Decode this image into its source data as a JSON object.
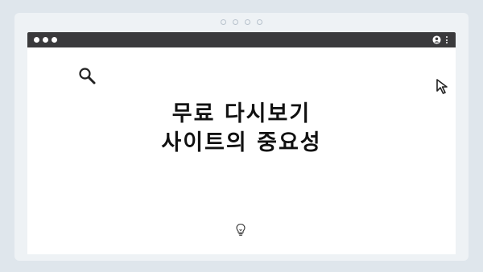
{
  "window": {
    "controls": [
      "close",
      "minimize",
      "maximize"
    ],
    "toolbar_icons": [
      "user-icon",
      "kebab-menu-icon"
    ]
  },
  "icons": [
    "search-icon",
    "cursor-icon",
    "lightbulb-icon"
  ],
  "headline": {
    "line1": "무료 다시보기",
    "line2": "사이트의 중요성"
  },
  "colors": {
    "page_background": "#dfe6ec",
    "card_background": "#eef2f5",
    "titlebar": "#3a3a3c",
    "text": "#111111"
  }
}
